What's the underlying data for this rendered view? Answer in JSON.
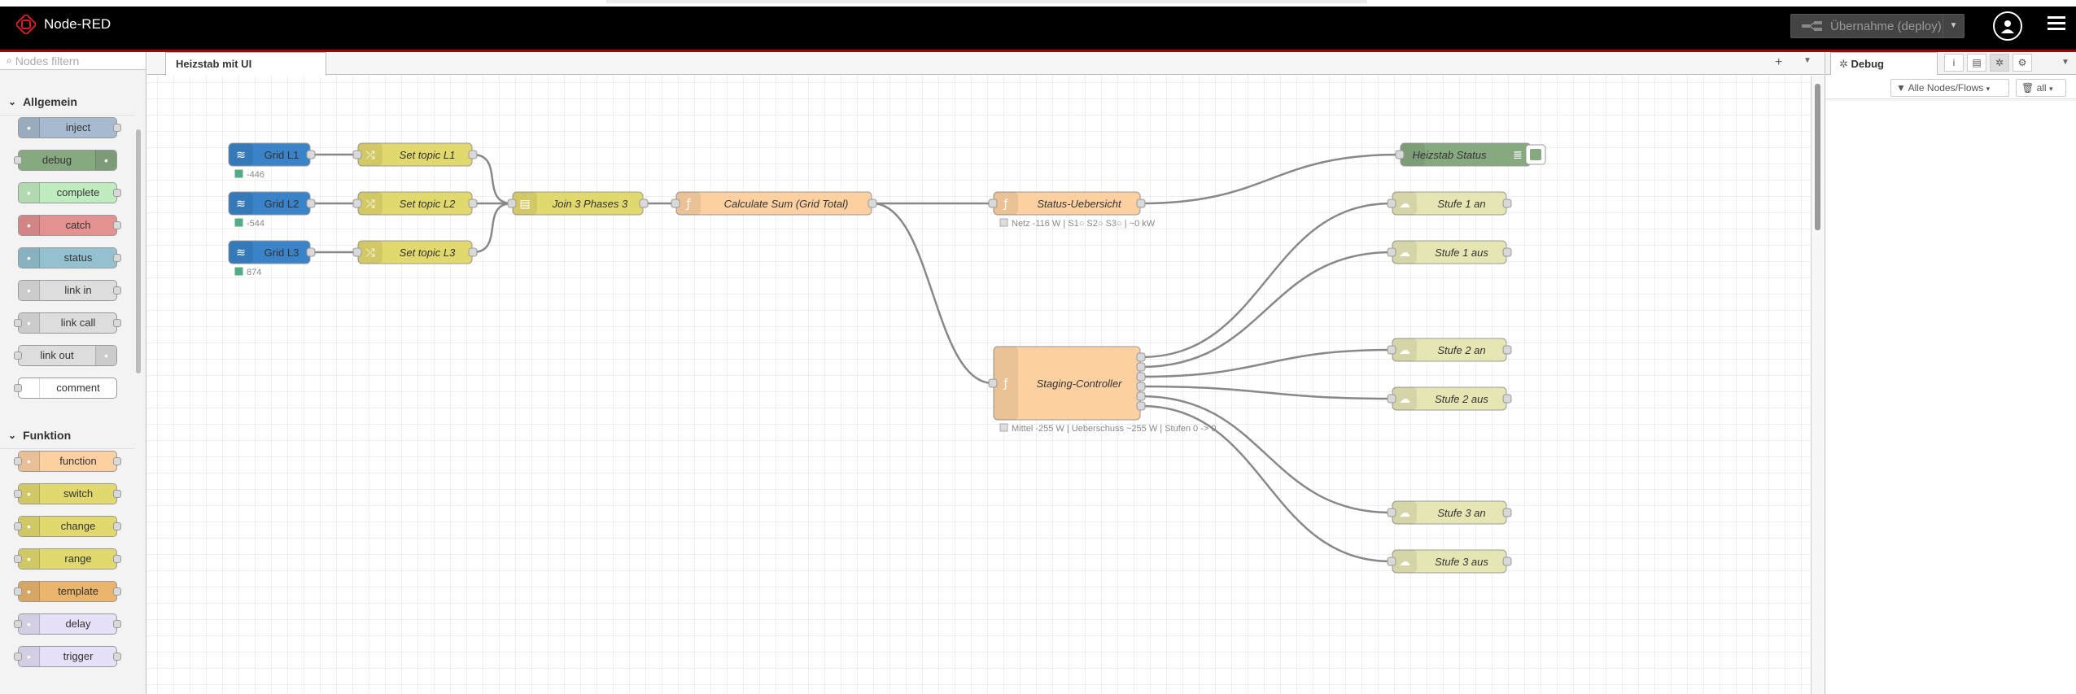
{
  "app": {
    "title": "Node-RED"
  },
  "header": {
    "deploy_label": "Übernahme (deploy)"
  },
  "palette": {
    "search_placeholder": "Nodes filtern",
    "categories": [
      {
        "label": "Allgemein",
        "nodes": [
          "inject",
          "debug",
          "complete",
          "catch",
          "status",
          "link in",
          "link call",
          "link out",
          "comment"
        ]
      },
      {
        "label": "Funktion",
        "nodes": [
          "function",
          "switch",
          "change",
          "range",
          "template",
          "delay",
          "trigger"
        ]
      }
    ]
  },
  "workspace": {
    "tab": "Heizstab mit UI",
    "nodes": [
      {
        "id": "grid-l1",
        "label": "Grid L1",
        "status": "-446",
        "color": "#3a83c8"
      },
      {
        "id": "grid-l2",
        "label": "Grid L2",
        "status": "-544",
        "color": "#3a83c8"
      },
      {
        "id": "grid-l3",
        "label": "Grid L3",
        "status": "874",
        "color": "#3a83c8"
      },
      {
        "id": "set-l1",
        "label": "Set topic L1",
        "color": "#e2d96e"
      },
      {
        "id": "set-l2",
        "label": "Set topic L2",
        "color": "#e2d96e"
      },
      {
        "id": "set-l3",
        "label": "Set topic L3",
        "color": "#e2d96e"
      },
      {
        "id": "join",
        "label": "Join 3 Phases 3",
        "color": "#e2d96e"
      },
      {
        "id": "calc",
        "label": "Calculate Sum (Grid Total)",
        "color": "#fdd0a2"
      },
      {
        "id": "status-ub",
        "label": "Status-Uebersicht",
        "status": "Netz -116 W | S1○ S2○ S3○ | ~0 kW",
        "color": "#fdd0a2"
      },
      {
        "id": "staging",
        "label": "Staging-Controller",
        "status": "Mittel -255 W | Ueberschuss ~255 W | Stufen 0 -> 0",
        "color": "#fdd0a2"
      },
      {
        "id": "heizstab-status",
        "label": "Heizstab Status",
        "color": "#87a980"
      },
      {
        "id": "s1an",
        "label": "Stufe 1 an",
        "color": "#e6e6b4"
      },
      {
        "id": "s1aus",
        "label": "Stufe 1 aus",
        "color": "#e6e6b4"
      },
      {
        "id": "s2an",
        "label": "Stufe 2 an",
        "color": "#e6e6b4"
      },
      {
        "id": "s2aus",
        "label": "Stufe 2 aus",
        "color": "#e6e6b4"
      },
      {
        "id": "s3an",
        "label": "Stufe 3 an",
        "color": "#e6e6b4"
      },
      {
        "id": "s3aus",
        "label": "Stufe 3 aus",
        "color": "#e6e6b4"
      }
    ]
  },
  "sidebar": {
    "tab": "Debug",
    "filter_label": "Alle Nodes/Flows",
    "clear_label": "all"
  }
}
